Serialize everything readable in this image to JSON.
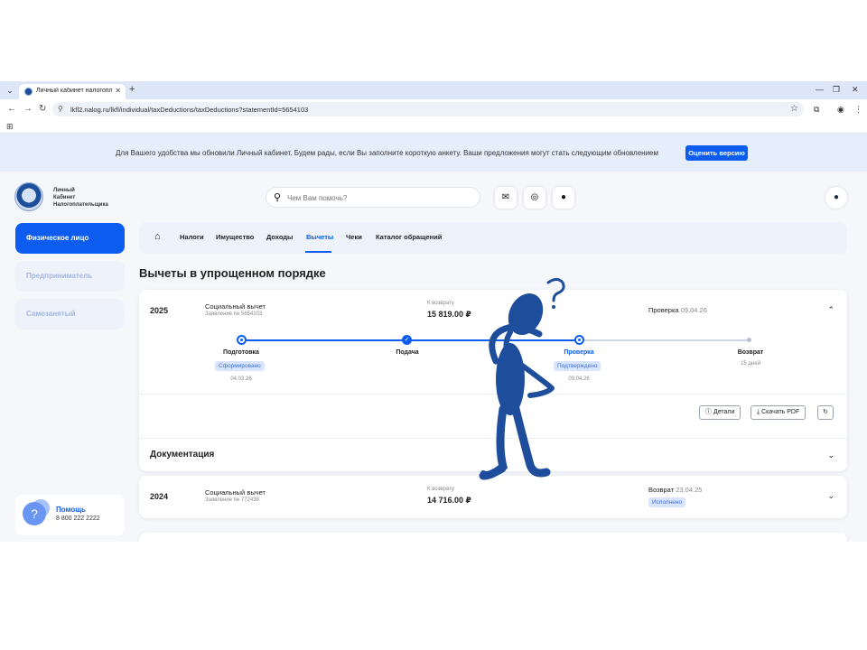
{
  "browser": {
    "tab_title": "Личный кабинет налогопла",
    "url": "lkfl2.nalog.ru/lkfl/individual/taxDeductions/taxDeductions?statementId=5654103"
  },
  "banner": {
    "text": "Для Вашего удобства мы обновили Личный кабинет. Будем рады, если Вы заполните короткую анкету. Ваши предложения могут стать следующим обновлением",
    "button": "Оценить версию"
  },
  "header": {
    "logo_lines": [
      "Личный",
      "Кабинет",
      "Налогоплательщика"
    ],
    "search_placeholder": "Чем Вам помочь?"
  },
  "sidebar": {
    "items": [
      {
        "label": "Физическое лицо"
      },
      {
        "label": "Предприниматель"
      },
      {
        "label": "Самозанятый"
      }
    ],
    "help": {
      "title": "Помощь",
      "phone": "8 800 222 2222"
    }
  },
  "nav": {
    "items": [
      "Налоги",
      "Имущество",
      "Доходы",
      "Вычеты",
      "Чеки",
      "Каталог обращений"
    ],
    "active": "Вычеты"
  },
  "page_title": "Вычеты в упрощенном порядке",
  "deductions": [
    {
      "year": "2025",
      "kind": "Социальный вычет",
      "statement": "Заявление № 5654103",
      "return_label": "К возврату",
      "return_value": "15 819.00 ₽",
      "status": "Проверка",
      "status_date": "09.04.26",
      "timeline": [
        {
          "label": "Подготовка",
          "badge": "Сформировано",
          "date": "04.03.26"
        },
        {
          "label": "Подача"
        },
        {
          "label": "Проверка",
          "badge": "Подтверждено",
          "date": "09.04.26"
        },
        {
          "label": "Возврат",
          "note": "15 дней"
        }
      ],
      "actions": {
        "details": "Детали",
        "download": "Скачать PDF"
      }
    },
    {
      "year": "2024",
      "kind": "Социальный вычет",
      "statement": "Заявление № 772438",
      "return_label": "К возврату",
      "return_value": "14 716.00 ₽",
      "status": "Возврат",
      "status_date": "23.04.25",
      "badge": "Исполнено"
    }
  ],
  "documentation": "Документация",
  "colors": {
    "accent": "#0d5cf0",
    "figure": "#1e4d9b"
  }
}
